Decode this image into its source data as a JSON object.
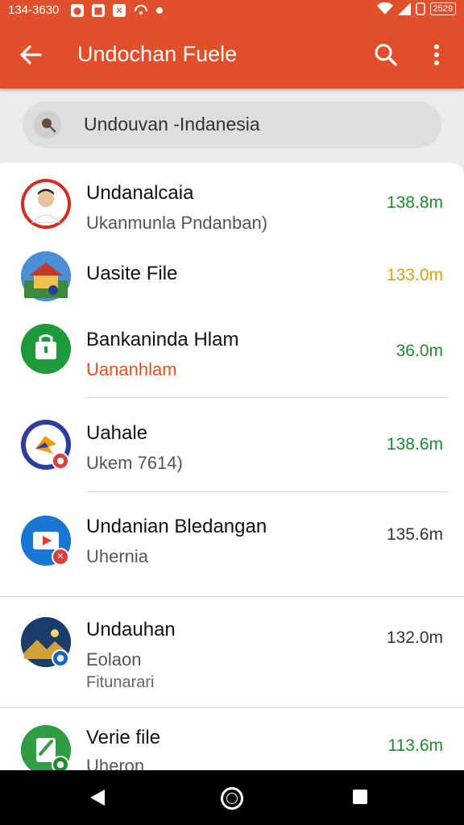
{
  "status_bar": {
    "time": "134-3630",
    "battery": "2529"
  },
  "app_bar": {
    "title": "Undochan Fuele"
  },
  "search": {
    "text": "Undouvan -Indanesia"
  },
  "list": {
    "items": [
      {
        "name": "Undanalcaia",
        "subtitle": "Ukanmunla Pndanban)",
        "size": "138.8m",
        "size_color": "#1e8a2e",
        "icon": "person-avatar-icon"
      },
      {
        "name": "Uasite File",
        "subtitle": "",
        "size": "133.0m",
        "size_color": "#d4a017",
        "icon": "house-scene-icon"
      },
      {
        "name": "Bankaninda Hlam",
        "subtitle": "Uananhlam",
        "size": "36.0m",
        "size_color": "#1e8a2e",
        "icon": "green-bag-icon"
      },
      {
        "name": "Uahale",
        "subtitle": "Ukem 7614)",
        "size": "138.6m",
        "size_color": "#1e8a2e",
        "icon": "bird-logo-icon"
      },
      {
        "name": "Undanian Bledangan",
        "subtitle": "Uhernia",
        "size": "135.6m",
        "size_color": "#333333",
        "icon": "video-play-icon"
      },
      {
        "name": "Undauhan",
        "subtitle": "Eolaon",
        "subtitle2": "Fitunarari",
        "size": "132.0m",
        "size_color": "#333333",
        "icon": "landscape-photo-icon"
      },
      {
        "name": "Verie file",
        "subtitle": "Uheron",
        "size": "113.6m",
        "size_color": "#1e8a2e",
        "icon": "green-edit-icon"
      }
    ]
  },
  "colors": {
    "accent": "#e24e2a",
    "subtitle_orange": "#e2501e"
  }
}
